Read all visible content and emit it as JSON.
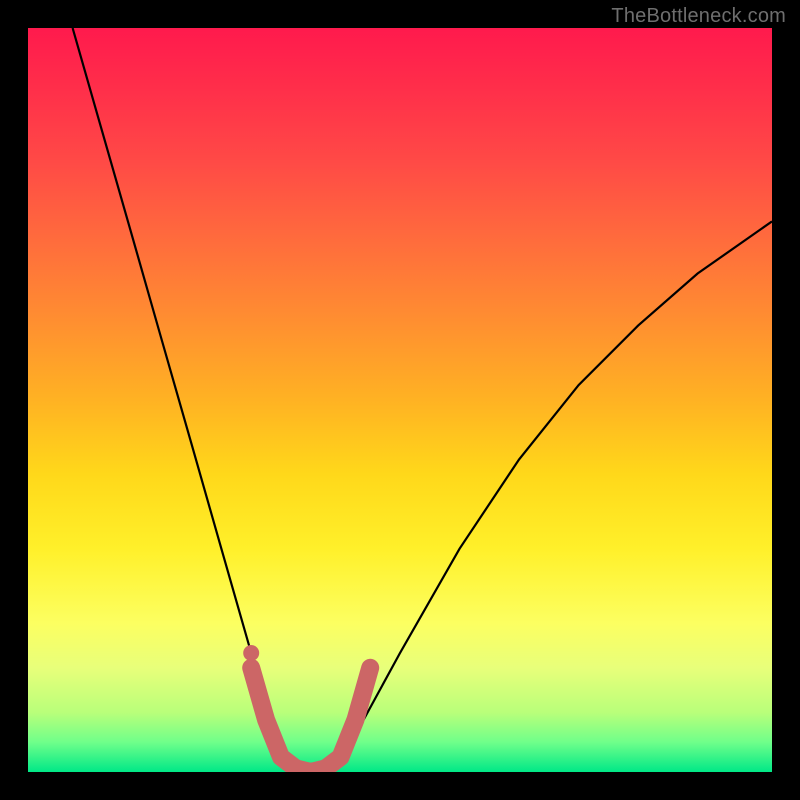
{
  "watermark": {
    "text": "TheBottleneck.com"
  },
  "chart_data": {
    "type": "line",
    "title": "",
    "xlabel": "",
    "ylabel": "",
    "xlim": [
      0,
      100
    ],
    "ylim": [
      0,
      100
    ],
    "background_gradient_stops": [
      {
        "pct": 0,
        "color": "#ff1a4d"
      },
      {
        "pct": 18,
        "color": "#ff4a46"
      },
      {
        "pct": 38,
        "color": "#ff8a32"
      },
      {
        "pct": 60,
        "color": "#ffd81a"
      },
      {
        "pct": 80,
        "color": "#fcff61"
      },
      {
        "pct": 92,
        "color": "#b9ff7a"
      },
      {
        "pct": 100,
        "color": "#00e887"
      }
    ],
    "series": [
      {
        "name": "bottleneck-curve",
        "stroke": "#000000",
        "points": [
          {
            "x": 6,
            "y": 100
          },
          {
            "x": 10,
            "y": 86
          },
          {
            "x": 14,
            "y": 72
          },
          {
            "x": 18,
            "y": 58
          },
          {
            "x": 22,
            "y": 44
          },
          {
            "x": 26,
            "y": 30
          },
          {
            "x": 30,
            "y": 16
          },
          {
            "x": 33,
            "y": 6
          },
          {
            "x": 35,
            "y": 1
          },
          {
            "x": 38,
            "y": 0
          },
          {
            "x": 41,
            "y": 1
          },
          {
            "x": 44,
            "y": 5
          },
          {
            "x": 50,
            "y": 16
          },
          {
            "x": 58,
            "y": 30
          },
          {
            "x": 66,
            "y": 42
          },
          {
            "x": 74,
            "y": 52
          },
          {
            "x": 82,
            "y": 60
          },
          {
            "x": 90,
            "y": 67
          },
          {
            "x": 100,
            "y": 74
          }
        ]
      },
      {
        "name": "highlight-band",
        "stroke": "#cc6666",
        "points": [
          {
            "x": 30,
            "y": 14
          },
          {
            "x": 32,
            "y": 7
          },
          {
            "x": 34,
            "y": 2
          },
          {
            "x": 36,
            "y": 0.5
          },
          {
            "x": 38,
            "y": 0
          },
          {
            "x": 40,
            "y": 0.5
          },
          {
            "x": 42,
            "y": 2
          },
          {
            "x": 44,
            "y": 7
          },
          {
            "x": 46,
            "y": 14
          }
        ]
      }
    ],
    "markers": [
      {
        "name": "highlight-dot",
        "x": 30,
        "y": 16,
        "color": "#cc6666"
      }
    ]
  }
}
